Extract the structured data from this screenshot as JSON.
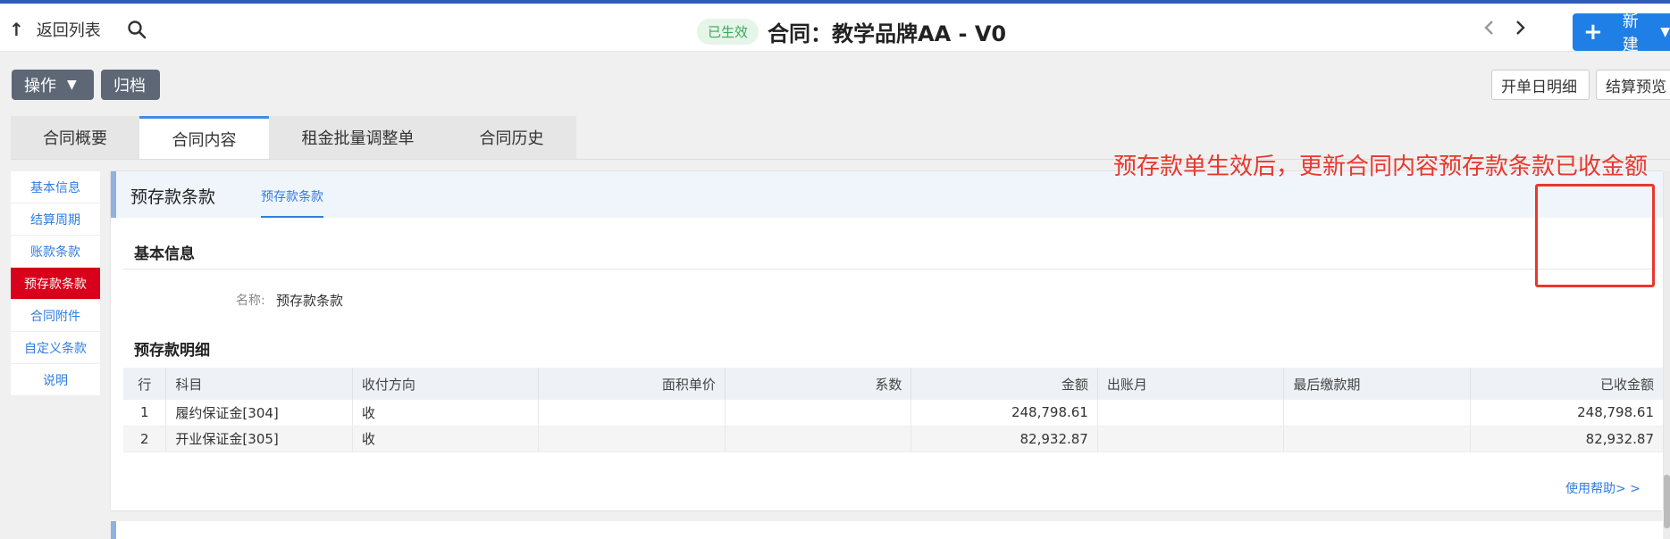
{
  "header": {
    "back_label": "返回列表",
    "status": "已生效",
    "title": "合同：教学品牌AA - V0",
    "new_label": "新建"
  },
  "toolbar": {
    "ops_label": "操作",
    "archive_label": "归档",
    "detail_label": "开单日明细",
    "settle_label": "结算预览"
  },
  "tabs": [
    "合同概要",
    "合同内容",
    "租金批量调整单",
    "合同历史"
  ],
  "sidebar": [
    "基本信息",
    "结算周期",
    "账款条款",
    "预存款条款",
    "合同附件",
    "自定义条款",
    "说明"
  ],
  "panel": {
    "title": "预存款条款",
    "tab": "预存款条款",
    "basic_title": "基本信息",
    "name_label": "名称:",
    "name_value": "预存款条款",
    "detail_title": "预存款明细",
    "help": "使用帮助> >"
  },
  "annotation": "预存款单生效后，更新合同内容预存款条款已收金额",
  "table": {
    "columns": [
      "行",
      "科目",
      "收付方向",
      "面积单价",
      "系数",
      "金额",
      "出账月",
      "最后缴款期",
      "已收金额"
    ],
    "rows": [
      [
        "1",
        "履约保证金[304]",
        "收",
        "",
        "",
        "248,798.61",
        "",
        "",
        "248,798.61"
      ],
      [
        "2",
        "开业保证金[305]",
        "收",
        "",
        "",
        "82,932.87",
        "",
        "",
        "82,932.87"
      ]
    ]
  },
  "colors": {
    "accent": "#1f7fe6",
    "active_sidebar": "#d9001b",
    "annotation": "#e8382d",
    "status_green": "#3aa85b"
  }
}
